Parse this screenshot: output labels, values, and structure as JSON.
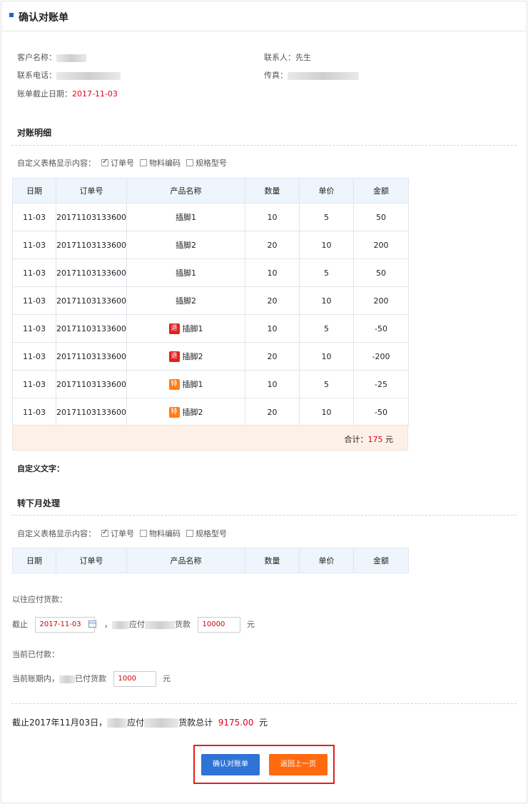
{
  "header": {
    "title": "确认对账单"
  },
  "info": {
    "customer_label": "客户名称：",
    "contact_label": "联系人：",
    "contact_value": "先生",
    "phone_label": "联系电话：",
    "fax_label": "传真：",
    "cutoff_label": "账单截止日期：",
    "cutoff_value": "2017-11-03"
  },
  "detail": {
    "title": "对账明细",
    "options_label": "自定义表格显示内容：",
    "options": [
      "订单号",
      "物料编码",
      "规格型号"
    ],
    "columns": [
      "日期",
      "订单号",
      "产品名称",
      "数量",
      "单价",
      "金额"
    ],
    "rows": [
      {
        "date": "11-03",
        "order": "20171103133600",
        "tag": "",
        "product": "插脚1",
        "qty": "10",
        "price": "5",
        "amount": "50"
      },
      {
        "date": "11-03",
        "order": "20171103133600",
        "tag": "",
        "product": "插脚2",
        "qty": "20",
        "price": "10",
        "amount": "200"
      },
      {
        "date": "11-03",
        "order": "20171103133600",
        "tag": "",
        "product": "插脚1",
        "qty": "10",
        "price": "5",
        "amount": "50"
      },
      {
        "date": "11-03",
        "order": "20171103133600",
        "tag": "",
        "product": "插脚2",
        "qty": "20",
        "price": "10",
        "amount": "200"
      },
      {
        "date": "11-03",
        "order": "20171103133600",
        "tag": "退",
        "product": "插脚1",
        "qty": "10",
        "price": "5",
        "amount": "-50"
      },
      {
        "date": "11-03",
        "order": "20171103133600",
        "tag": "退",
        "product": "插脚2",
        "qty": "20",
        "price": "10",
        "amount": "-200"
      },
      {
        "date": "11-03",
        "order": "20171103133600",
        "tag": "特",
        "product": "插脚1",
        "qty": "10",
        "price": "5",
        "amount": "-25"
      },
      {
        "date": "11-03",
        "order": "20171103133600",
        "tag": "特",
        "product": "插脚2",
        "qty": "20",
        "price": "10",
        "amount": "-50"
      }
    ],
    "total_label": "合计：",
    "total_value": "175",
    "total_unit": "元"
  },
  "custom_text_label": "自定义文字：",
  "next_month": {
    "title": "转下月处理",
    "options_label": "自定义表格显示内容：",
    "options": [
      "订单号",
      "物料编码",
      "规格型号"
    ],
    "columns": [
      "日期",
      "订单号",
      "产品名称",
      "数量",
      "单价",
      "金额"
    ]
  },
  "payable": {
    "prior_label": "以往应付货款：",
    "cutoff_prefix": "截止",
    "cutoff_date": "2017-11-03",
    "comma": "，",
    "due_text": "应付",
    "goods_text": "货款",
    "prior_amount": "10000",
    "unit": "元",
    "paid_label": "当前已付款：",
    "period_prefix": "当前账期内，",
    "paid_text": "已付货款",
    "paid_amount": "1000"
  },
  "summary": {
    "prefix": "截止2017年11月03日，",
    "due_text": "应付",
    "total_text": "货款总计",
    "amount": "9175.00",
    "unit": "元"
  },
  "buttons": {
    "confirm": "确认对账单",
    "back": "返回上一页"
  },
  "colors": {
    "accent": "#2e73d6",
    "orange": "#ff6a0f",
    "red": "#e0001b"
  }
}
